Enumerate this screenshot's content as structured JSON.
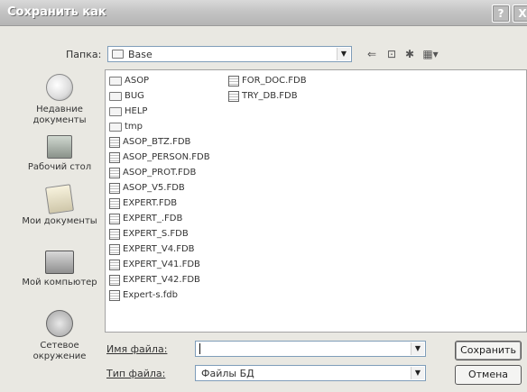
{
  "title": "Сохранить как",
  "titlebar_buttons": {
    "help": "?",
    "close": "X"
  },
  "folder_label": "Папка:",
  "folder_value": "Base",
  "toolbar_icons": [
    "back-arrow-icon",
    "up-folder-icon",
    "new-folder-icon",
    "views-menu-icon"
  ],
  "places": [
    {
      "label": "Недавние\nдокументы",
      "icon": "recent-documents-icon"
    },
    {
      "label": "Рабочий стол",
      "icon": "desktop-icon"
    },
    {
      "label": "Мои документы",
      "icon": "my-documents-icon"
    },
    {
      "label": "Мой компьютер",
      "icon": "my-computer-icon"
    },
    {
      "label": "Сетевое\nокружение",
      "icon": "network-icon"
    }
  ],
  "files_col1": [
    {
      "name": "ASOP",
      "type": "folder"
    },
    {
      "name": "BUG",
      "type": "folder"
    },
    {
      "name": "HELP",
      "type": "folder"
    },
    {
      "name": "tmp",
      "type": "folder"
    },
    {
      "name": "ASOP_BTZ.FDB",
      "type": "db"
    },
    {
      "name": "ASOP_PERSON.FDB",
      "type": "db"
    },
    {
      "name": "ASOP_PROT.FDB",
      "type": "db"
    },
    {
      "name": "ASOP_V5.FDB",
      "type": "db"
    },
    {
      "name": "EXPERT.FDB",
      "type": "db"
    },
    {
      "name": "EXPERT_.FDB",
      "type": "db"
    },
    {
      "name": "EXPERT_S.FDB",
      "type": "db"
    },
    {
      "name": "EXPERT_V4.FDB",
      "type": "db"
    },
    {
      "name": "EXPERT_V41.FDB",
      "type": "db"
    },
    {
      "name": "EXPERT_V42.FDB",
      "type": "db"
    },
    {
      "name": "Expert-s.fdb",
      "type": "db"
    }
  ],
  "files_col2": [
    {
      "name": "FOR_DOC.FDB",
      "type": "db"
    },
    {
      "name": "TRY_DB.FDB",
      "type": "db"
    }
  ],
  "filename_label": "Имя файла:",
  "filename_value": "",
  "filetype_label": "Тип файла:",
  "filetype_value": "Файлы БД",
  "save_button": "Сохранить",
  "cancel_button": "Отмена"
}
